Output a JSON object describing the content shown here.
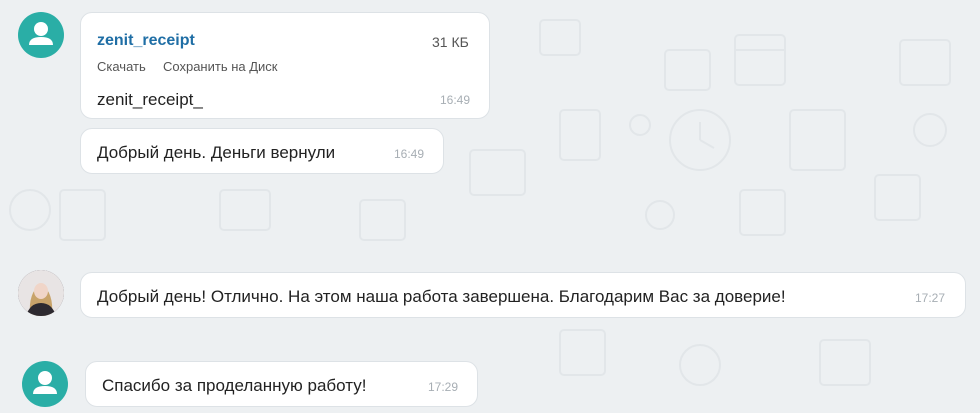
{
  "messages": [
    {
      "type": "file",
      "file_name": "zenit_receipt",
      "file_size": "31 КБ",
      "actions": {
        "download": "Скачать",
        "save_to_disk": "Сохранить на Диск"
      },
      "text": "zenit_receipt_",
      "time": "16:49"
    },
    {
      "type": "text",
      "text": "Добрый день. Деньги вернули",
      "time": "16:49"
    },
    {
      "type": "text",
      "text": "Добрый день! Отлично. На этом наша работа завершена. Благодарим Вас за доверие!",
      "time": "17:27"
    },
    {
      "type": "text",
      "text": "Спасибо за проделанную работу!",
      "time": "17:29"
    }
  ],
  "colors": {
    "background": "#edf0f2",
    "bubble": "#ffffff",
    "avatar_generic": "#2aaea6",
    "file_link": "#1f6ea5",
    "timestamp": "#a7aeb4"
  },
  "icons": [
    "user-silhouette-icon",
    "contact-photo"
  ]
}
